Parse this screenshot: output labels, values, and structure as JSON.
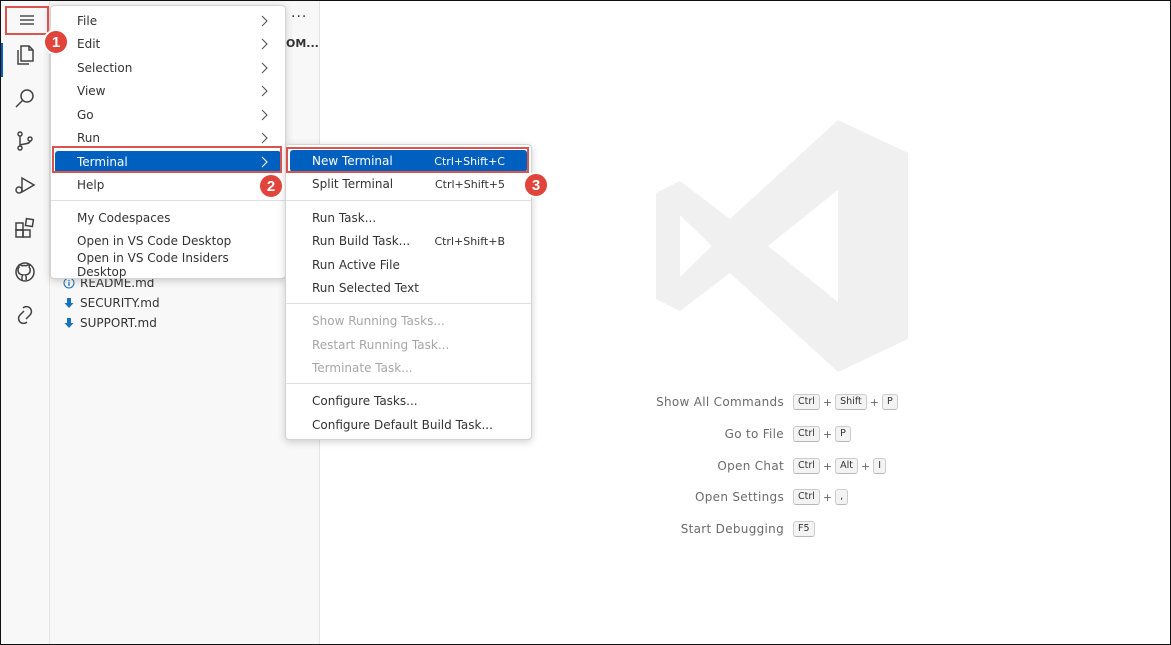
{
  "menu": {
    "items": [
      {
        "label": "File",
        "has_submenu": true
      },
      {
        "label": "Edit",
        "has_submenu": true
      },
      {
        "label": "Selection",
        "has_submenu": true
      },
      {
        "label": "View",
        "has_submenu": true
      },
      {
        "label": "Go",
        "has_submenu": true
      },
      {
        "label": "Run",
        "has_submenu": true
      },
      {
        "label": "Terminal",
        "has_submenu": true,
        "selected": true
      },
      {
        "label": "Help",
        "has_submenu": true
      }
    ],
    "extra_items": [
      {
        "label": "My Codespaces"
      },
      {
        "label": "Open in VS Code Desktop"
      },
      {
        "label": "Open in VS Code Insiders Desktop"
      }
    ]
  },
  "terminal_menu": {
    "items": [
      {
        "label": "New Terminal",
        "shortcut": "Ctrl+Shift+C",
        "selected": true
      },
      {
        "label": "Split Terminal",
        "shortcut": "Ctrl+Shift+5"
      },
      {
        "label": "Run Task...",
        "shortcut": ""
      },
      {
        "label": "Run Build Task...",
        "shortcut": "Ctrl+Shift+B"
      },
      {
        "label": "Run Active File",
        "shortcut": ""
      },
      {
        "label": "Run Selected Text",
        "shortcut": ""
      },
      {
        "label": "Show Running Tasks...",
        "shortcut": "",
        "disabled": true
      },
      {
        "label": "Restart Running Task...",
        "shortcut": "",
        "disabled": true
      },
      {
        "label": "Terminate Task...",
        "shortcut": "",
        "disabled": true
      },
      {
        "label": "Configure Tasks...",
        "shortcut": ""
      },
      {
        "label": "Configure Default Build Task...",
        "shortcut": ""
      }
    ]
  },
  "sidebar": {
    "more_actions": "···",
    "truncated_title": "OM...",
    "files": [
      {
        "name": "README.md",
        "icon": "info-icon"
      },
      {
        "name": "SECURITY.md",
        "icon": "markdown-arrow-icon"
      },
      {
        "name": "SUPPORT.md",
        "icon": "markdown-arrow-icon"
      }
    ]
  },
  "activity_bar": {
    "icons": [
      "menu-icon",
      "explorer-icon",
      "search-icon",
      "source-control-icon",
      "run-debug-icon",
      "extensions-icon",
      "github-icon",
      "live-share-icon"
    ]
  },
  "shortcuts": [
    {
      "label": "Show All Commands",
      "keys": [
        "Ctrl",
        "Shift",
        "P"
      ]
    },
    {
      "label": "Go to File",
      "keys": [
        "Ctrl",
        "P"
      ]
    },
    {
      "label": "Open Chat",
      "keys": [
        "Ctrl",
        "Alt",
        "I"
      ]
    },
    {
      "label": "Open Settings",
      "keys": [
        "Ctrl",
        ","
      ]
    },
    {
      "label": "Start Debugging",
      "keys": [
        "F5"
      ]
    }
  ],
  "callouts": {
    "step1": "1",
    "step2": "2",
    "step3": "3"
  },
  "colors": {
    "highlight": "#d9534f",
    "badge": "#e0443a",
    "selection": "#0060c0",
    "watermark": "#f0f0f0"
  }
}
